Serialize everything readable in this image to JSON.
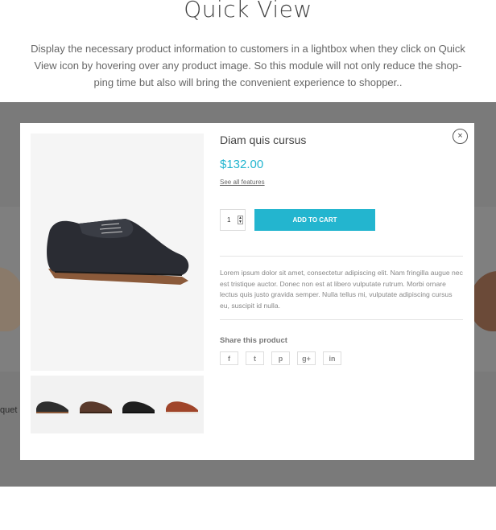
{
  "hero": {
    "title": "Quick View",
    "description": "Display the necessary product information to customers in a lightbox when they click on Quick View icon by hovering over any product image. So this module will not only reduce the shop-ping time but also will bring the convenient experience to shopper.."
  },
  "background": {
    "partial_text": "quet"
  },
  "modal": {
    "close_label": "×",
    "product": {
      "title": "Diam quis cursus",
      "price": "$132.00",
      "see_all": "See all features",
      "quantity": "1",
      "add_to_cart": "ADD TO CART",
      "description": "Lorem ipsum dolor sit amet, consectetur adipiscing elit. Nam fringilla augue nec est tristique auctor. Donec non est at libero vulputate rutrum. Morbi ornare lectus quis justo gravida semper. Nulla tellus mi, vulputate adipiscing cursus eu, suscipit id nulla.",
      "share_label": "Share this product",
      "share_buttons": [
        {
          "icon": "facebook-icon",
          "glyph": "f"
        },
        {
          "icon": "twitter-icon",
          "glyph": "t"
        },
        {
          "icon": "pinterest-icon",
          "glyph": "p"
        },
        {
          "icon": "google-plus-icon",
          "glyph": "g+"
        },
        {
          "icon": "linkedin-icon",
          "glyph": "in"
        }
      ],
      "thumbnails": [
        {
          "name": "thumb-black-shoe",
          "color": "#2e2e2e"
        },
        {
          "name": "thumb-brown-shoe",
          "color": "#5a3a2c"
        },
        {
          "name": "thumb-dark-shoe",
          "color": "#1f1f1f"
        },
        {
          "name": "thumb-tan-shoe",
          "color": "#a0452a"
        }
      ]
    }
  },
  "colors": {
    "accent": "#23b5cf",
    "overlay": "#7a7a7a"
  }
}
